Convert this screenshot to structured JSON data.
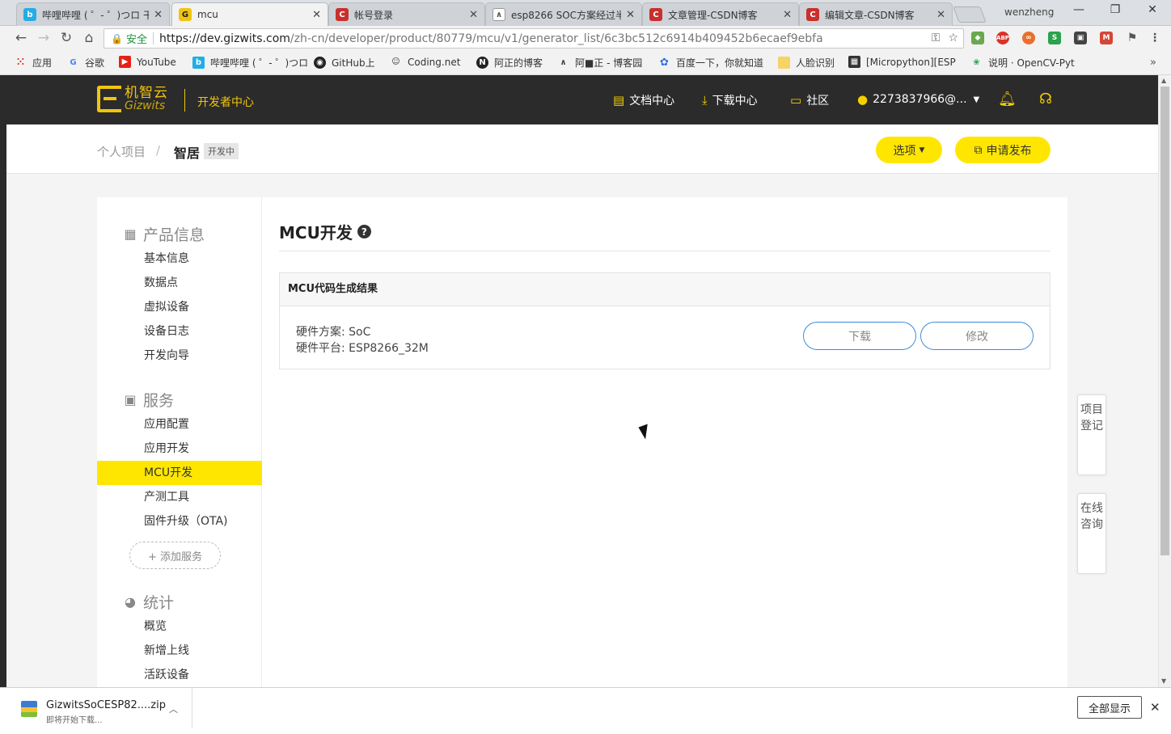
{
  "browser": {
    "tabs": [
      {
        "title": "哔哩哔哩 ( ゜- ゜)つロ 干杯",
        "favicon": "bilibili-icon",
        "color": "#23ade5"
      },
      {
        "title": "mcu",
        "favicon": "gizwits-icon",
        "color": "#f1c40f"
      },
      {
        "title": "帐号登录",
        "favicon": "csdn-icon",
        "color": "#c9302c"
      },
      {
        "title": "esp8266 SOC方案经过半",
        "favicon": "blog-icon",
        "color": "#555555"
      },
      {
        "title": "文章管理-CSDN博客",
        "favicon": "csdn-icon",
        "color": "#c9302c"
      },
      {
        "title": "编辑文章-CSDN博客",
        "favicon": "csdn-icon",
        "color": "#c9302c"
      }
    ],
    "profile_name": "wenzheng",
    "secure_label": "安全",
    "url_host": "https://dev.gizwits.com",
    "url_path": "/zh-cn/developer/product/80779/mcu/v1/generator_list/6c3bc512c6914b409452b6ecaef9ebfa",
    "bookmarks": [
      {
        "label": "应用",
        "icon": "apps-grid-icon"
      },
      {
        "label": "谷歌",
        "icon": "google-icon"
      },
      {
        "label": "YouTube",
        "icon": "youtube-icon"
      },
      {
        "label": "哔哩哔哩 ( ゜- ゜)つロ",
        "icon": "bilibili-icon"
      },
      {
        "label": "GitHub上",
        "icon": "github-icon"
      },
      {
        "label": "Coding.net",
        "icon": "coding-icon"
      },
      {
        "label": "阿正的博客",
        "icon": "notion-icon"
      },
      {
        "label": "阿■正 - 博客园",
        "icon": "blog-icon"
      },
      {
        "label": "百度一下，你就知道",
        "icon": "baidu-icon"
      },
      {
        "label": "人脸识别",
        "icon": "folder-icon"
      },
      {
        "label": "[Micropython][ESP",
        "icon": "page-icon"
      },
      {
        "label": "说明 · OpenCV-Pyt",
        "icon": "opencv-icon"
      }
    ],
    "bookmarks_more": "»"
  },
  "header": {
    "logo_cn": "机智云",
    "logo_en": "Gizwits",
    "dev_center": "开发者中心",
    "nav": {
      "docs": "文档中心",
      "downloads": "下载中心",
      "community": "社区",
      "account": "2273837966@..."
    }
  },
  "breadcrumb": {
    "parent": "个人项目",
    "separator": "/",
    "current": "智居",
    "status_badge": "开发中",
    "options_button": "选项",
    "publish_button": "申请发布"
  },
  "sidebar": {
    "sections": [
      {
        "title": "产品信息",
        "items": [
          "基本信息",
          "数据点",
          "虚拟设备",
          "设备日志",
          "开发向导"
        ]
      },
      {
        "title": "服务",
        "items": [
          "应用配置",
          "应用开发",
          "MCU开发",
          "产测工具",
          "固件升级（OTA)"
        ]
      },
      {
        "title": "统计",
        "items": [
          "概览",
          "新增上线",
          "活跃设备"
        ]
      }
    ],
    "active_item": "MCU开发",
    "add_service": "+ 添加服务"
  },
  "main": {
    "title": "MCU开发",
    "result_title": "MCU代码生成结果",
    "hardware_scheme": "硬件方案: SoC",
    "hardware_platform": "硬件平台: ESP8266_32M",
    "download_button": "下载",
    "modify_button": "修改"
  },
  "float_tabs": {
    "register": "项目登记",
    "consult": "在线咨询"
  },
  "download_shelf": {
    "filename": "GizwitsSoCESP82....zip",
    "status": "即将开始下载...",
    "show_all": "全部显示"
  },
  "colors": {
    "accent_yellow": "#ffe600",
    "header_dark": "#2b2b2b",
    "button_border_blue": "#3c8dd9"
  }
}
